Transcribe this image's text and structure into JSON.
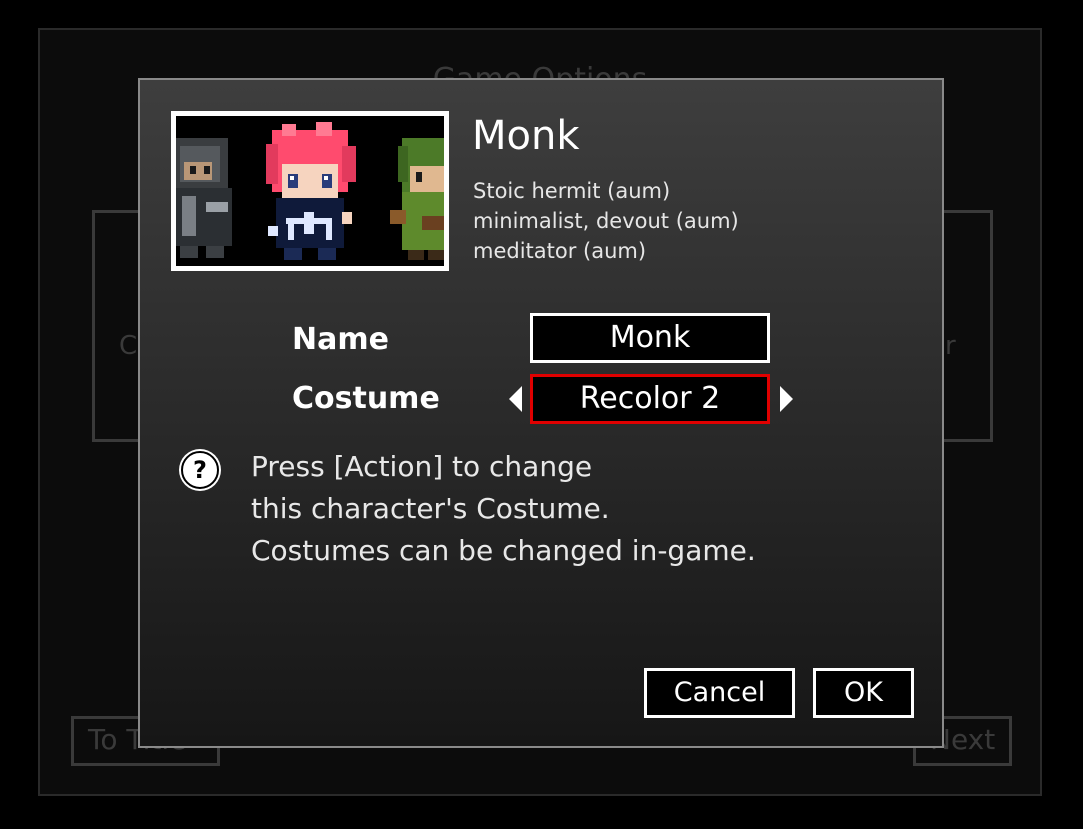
{
  "background": {
    "title": "Game Options",
    "left_panel_text": "C",
    "right_panel_text": "er",
    "to_title_button": "To Title",
    "next_button": "Next"
  },
  "dialog": {
    "character": {
      "name": "Monk",
      "description": [
        "Stoic hermit (aum)",
        "minimalist, devout (aum)",
        "meditator (aum)"
      ]
    },
    "fields": {
      "name_label": "Name",
      "name_value": "Monk",
      "costume_label": "Costume",
      "costume_value": "Recolor 2"
    },
    "help": {
      "icon": "?",
      "lines": [
        "Press [Action] to change",
        "this character's Costume.",
        "Costumes can be changed in-game."
      ]
    },
    "buttons": {
      "cancel": "Cancel",
      "ok": "OK"
    }
  },
  "colors": {
    "selection_border": "#e00000",
    "hair": "#ff4b6e",
    "dialog_border": "#8a8a8a"
  }
}
